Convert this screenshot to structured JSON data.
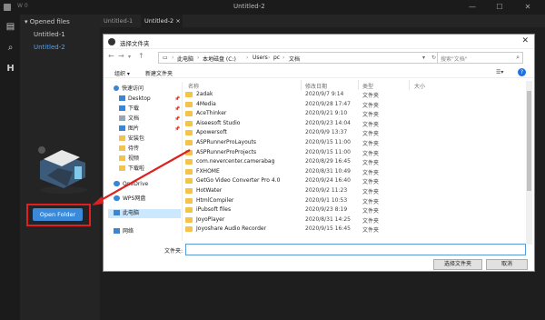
{
  "app": {
    "window_title": "Untitled-2",
    "app_label": "W 0"
  },
  "sidebar": {
    "header": "Opened files",
    "files": [
      "Untitled-1",
      "Untitled-2"
    ],
    "open_folder": "Open Folder"
  },
  "tabs": [
    {
      "label": "Untitled-1"
    },
    {
      "label": "Untitled-2",
      "close": "×"
    }
  ],
  "dialog": {
    "title": "选择文件夹",
    "close": "✕",
    "address": [
      "此电脑",
      "本地磁盘 (C:)",
      "Users",
      "pc",
      "文档"
    ],
    "search_placeholder": "搜索\"文档\"",
    "organize": "组织 ▾",
    "new_folder": "新建文件夹",
    "nav": [
      {
        "label": "快速访问",
        "pinned": false
      },
      {
        "label": "Desktop",
        "pinned": true
      },
      {
        "label": "下载",
        "pinned": true
      },
      {
        "label": "文档",
        "pinned": true
      },
      {
        "label": "图片",
        "pinned": true
      },
      {
        "label": "安装包",
        "pinned": false
      },
      {
        "label": "待传",
        "pinned": false
      },
      {
        "label": "视频",
        "pinned": false
      },
      {
        "label": "下载啦",
        "pinned": false
      },
      {
        "label": "OneDrive",
        "pinned": false
      },
      {
        "label": "WPS网盘",
        "pinned": false
      },
      {
        "label": "此电脑",
        "pinned": false
      },
      {
        "label": "网络",
        "pinned": false
      }
    ],
    "columns": {
      "name": "名称",
      "date": "修改日期",
      "type": "类型",
      "size": "大小"
    },
    "files": [
      {
        "name": "2adak",
        "date": "2020/9/7 9:14",
        "type": "文件夹"
      },
      {
        "name": "4Media",
        "date": "2020/9/28 17:47",
        "type": "文件夹"
      },
      {
        "name": "AceThinker",
        "date": "2020/9/21 9:10",
        "type": "文件夹"
      },
      {
        "name": "Aiseesoft Studio",
        "date": "2020/9/23 14:04",
        "type": "文件夹"
      },
      {
        "name": "Apowersoft",
        "date": "2020/9/9 13:37",
        "type": "文件夹"
      },
      {
        "name": "ASPRunnerProLayouts",
        "date": "2020/9/15 11:00",
        "type": "文件夹"
      },
      {
        "name": "ASPRunnerProProjects",
        "date": "2020/9/15 11:00",
        "type": "文件夹"
      },
      {
        "name": "com.nevercenter.camerabag",
        "date": "2020/8/29 16:45",
        "type": "文件夹"
      },
      {
        "name": "FXHOME",
        "date": "2020/8/31 10:49",
        "type": "文件夹"
      },
      {
        "name": "GetGo Video Converter Pro 4.0",
        "date": "2020/9/24 16:40",
        "type": "文件夹"
      },
      {
        "name": "HotWater",
        "date": "2020/9/2 11:23",
        "type": "文件夹"
      },
      {
        "name": "HtmlCompiler",
        "date": "2020/9/1 10:53",
        "type": "文件夹"
      },
      {
        "name": "iPubsoft files",
        "date": "2020/9/23 8:19",
        "type": "文件夹"
      },
      {
        "name": "JoyoPlayer",
        "date": "2020/8/31 14:25",
        "type": "文件夹"
      },
      {
        "name": "Joyoshare Audio Recorder",
        "date": "2020/9/15 16:45",
        "type": "文件夹"
      }
    ],
    "filename_label": "文件夹:",
    "select_button": "选择文件夹",
    "cancel_button": "取消"
  }
}
